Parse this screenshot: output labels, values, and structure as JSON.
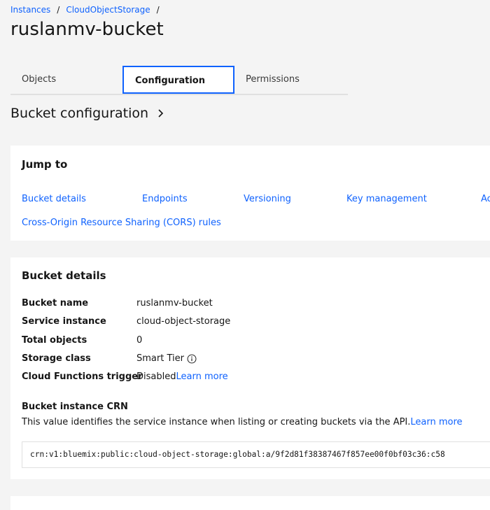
{
  "breadcrumb": {
    "items": [
      "Instances",
      "CloudObjectStorage"
    ],
    "separator": "/"
  },
  "page": {
    "title": "ruslanmv-bucket"
  },
  "tabs": [
    {
      "label": "Objects",
      "active": false
    },
    {
      "label": "Configuration",
      "active": true
    },
    {
      "label": "Permissions",
      "active": false
    }
  ],
  "section": {
    "title": "Bucket configuration"
  },
  "jump": {
    "title": "Jump to",
    "links": [
      "Bucket details",
      "Endpoints",
      "Versioning",
      "Key management",
      "Ac",
      "Cross-Origin Resource Sharing (CORS) rules"
    ]
  },
  "details": {
    "title": "Bucket details",
    "rows": [
      {
        "key": "Bucket name",
        "value": "ruslanmv-bucket"
      },
      {
        "key": "Service instance",
        "value": "cloud-object-storage"
      },
      {
        "key": "Total objects",
        "value": "0"
      },
      {
        "key": "Storage class",
        "value": "Smart Tier"
      },
      {
        "key": "Cloud Functions trigger",
        "value": "Disabled",
        "link": "Learn more"
      }
    ],
    "crn": {
      "title": "Bucket instance CRN",
      "description": "This value identifies the service instance when listing or creating buckets via the API.",
      "description_link": "Learn more",
      "value": "crn:v1:bluemix:public:cloud-object-storage:global:a/9f2d81f38387467f857ee00f0bf03c36:c58"
    }
  },
  "colors": {
    "link": "#0f62fe",
    "active_tab_border": "#0f62fe",
    "background": "#f4f4f4"
  }
}
